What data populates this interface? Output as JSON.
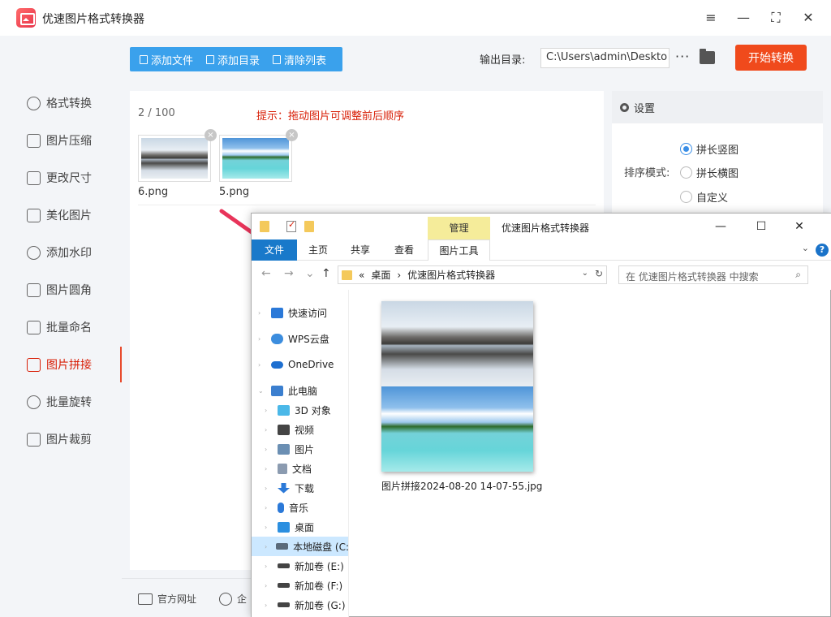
{
  "app": {
    "title": "优速图片格式转换器",
    "window_controls": [
      "≡",
      "—",
      "⛶",
      "✕"
    ]
  },
  "sidebar": {
    "items": [
      {
        "label": "格式转换",
        "icon": "format-convert-icon",
        "active": false
      },
      {
        "label": "图片压缩",
        "icon": "compress-icon",
        "active": false
      },
      {
        "label": "更改尺寸",
        "icon": "resize-icon",
        "active": false
      },
      {
        "label": "美化图片",
        "icon": "beautify-icon",
        "active": false
      },
      {
        "label": "添加水印",
        "icon": "watermark-icon",
        "active": false
      },
      {
        "label": "图片圆角",
        "icon": "round-corner-icon",
        "active": false
      },
      {
        "label": "批量命名",
        "icon": "rename-icon",
        "active": false
      },
      {
        "label": "图片拼接",
        "icon": "stitch-icon",
        "active": true
      },
      {
        "label": "批量旋转",
        "icon": "rotate-icon",
        "active": false
      },
      {
        "label": "图片裁剪",
        "icon": "crop-icon",
        "active": false
      }
    ]
  },
  "toolbar": {
    "add_file": "添加文件",
    "add_dir": "添加目录",
    "clear_list": "清除列表",
    "output_label": "输出目录:",
    "output_path": "C:\\Users\\admin\\Deskto",
    "more": "···",
    "start": "开始转换"
  },
  "main": {
    "count": "2 / 100",
    "hint": "提示：拖动图片可调整前后顺序",
    "files": [
      {
        "name": "6.png",
        "remove": "×"
      },
      {
        "name": "5.png",
        "remove": "×"
      }
    ]
  },
  "settings": {
    "title": "设置",
    "sort_label": "排序模式:",
    "options": [
      {
        "label": "拼长竖图",
        "checked": true
      },
      {
        "label": "拼长横图",
        "checked": false
      },
      {
        "label": "自定义",
        "checked": false
      }
    ]
  },
  "footer": {
    "website": "官方网址",
    "enterprise": "企"
  },
  "explorer": {
    "manage_tab": "管理",
    "caption": "优速图片格式转换器",
    "controls": [
      "—",
      "☐",
      "✕"
    ],
    "ribbon_tabs": [
      "文件",
      "主页",
      "共享",
      "查看",
      "图片工具"
    ],
    "help": "?",
    "address": {
      "prefix": "«",
      "segments": [
        "桌面",
        "›",
        "优速图片格式转换器"
      ]
    },
    "search_placeholder": "在 优速图片格式转换器 中搜索",
    "tree": [
      {
        "label": "快速访问",
        "icon": "star-icon",
        "color": "#2b79d8",
        "level": 1
      },
      {
        "label": "WPS云盘",
        "icon": "cloud-icon",
        "color": "#3c8dde",
        "level": 1
      },
      {
        "label": "OneDrive",
        "icon": "onedrive-icon",
        "color": "#1e6fd0",
        "level": 1
      },
      {
        "label": "此电脑",
        "icon": "pc-icon",
        "color": "#3b7fcf",
        "level": 1
      },
      {
        "label": "3D 对象",
        "icon": "cube-icon",
        "color": "#4bb8e8",
        "level": 2
      },
      {
        "label": "视频",
        "icon": "video-icon",
        "color": "#444444",
        "level": 2
      },
      {
        "label": "图片",
        "icon": "picture-icon",
        "color": "#6b8fb3",
        "level": 2
      },
      {
        "label": "文档",
        "icon": "document-icon",
        "color": "#8b9bb0",
        "level": 2
      },
      {
        "label": "下载",
        "icon": "download-icon",
        "color": "#2b79d8",
        "level": 2
      },
      {
        "label": "音乐",
        "icon": "music-icon",
        "color": "#2b79d8",
        "level": 2
      },
      {
        "label": "桌面",
        "icon": "desktop-icon",
        "color": "#2b8fe0",
        "level": 2
      },
      {
        "label": "本地磁盘 (C:",
        "icon": "drive-c-icon",
        "color": "#5a6a7a",
        "level": 2,
        "selected": true
      },
      {
        "label": "新加卷 (E:)",
        "icon": "drive-icon",
        "color": "#444444",
        "level": 2
      },
      {
        "label": "新加卷 (F:)",
        "icon": "drive-icon",
        "color": "#444444",
        "level": 2
      },
      {
        "label": "新加卷 (G:)",
        "icon": "drive-icon",
        "color": "#444444",
        "level": 2
      }
    ],
    "result_file": "图片拼接2024-08-20 14-07-55.jpg"
  },
  "colors": {
    "accent_blue": "#3aa1ec",
    "start_red": "#f04a1c",
    "hint_red": "#d81e06",
    "file_tab_blue": "#1979ca",
    "manage_yellow": "#f5ec9a"
  }
}
